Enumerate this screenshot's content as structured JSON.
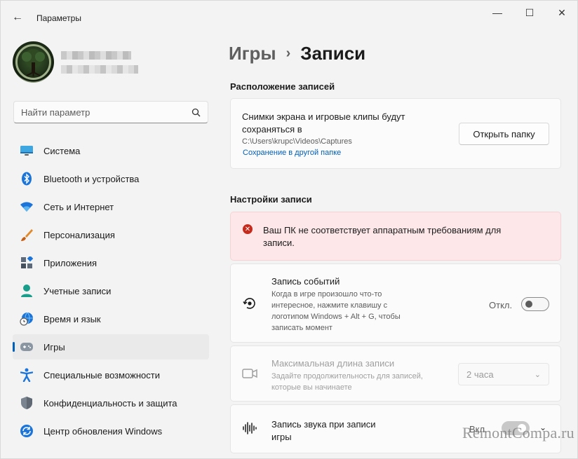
{
  "window": {
    "title": "Параметры",
    "controls": {
      "minimize": "—",
      "maximize": "☐",
      "close": "✕"
    }
  },
  "search": {
    "placeholder": "Найти параметр"
  },
  "nav": {
    "items": [
      {
        "label": "Система",
        "icon": "monitor-icon"
      },
      {
        "label": "Bluetooth и устройства",
        "icon": "bluetooth-icon"
      },
      {
        "label": "Сеть и Интернет",
        "icon": "wifi-icon"
      },
      {
        "label": "Персонализация",
        "icon": "brush-icon"
      },
      {
        "label": "Приложения",
        "icon": "apps-icon"
      },
      {
        "label": "Учетные записи",
        "icon": "account-icon"
      },
      {
        "label": "Время и язык",
        "icon": "globe-clock-icon"
      },
      {
        "label": "Игры",
        "icon": "gamepad-icon",
        "active": true
      },
      {
        "label": "Специальные возможности",
        "icon": "accessibility-icon"
      },
      {
        "label": "Конфиденциальность и защита",
        "icon": "shield-icon"
      },
      {
        "label": "Центр обновления Windows",
        "icon": "update-icon"
      }
    ]
  },
  "breadcrumb": {
    "parent": "Игры",
    "separator": "›",
    "current": "Записи"
  },
  "location": {
    "section_title": "Расположение записей",
    "text": "Снимки экрана и игровые клипы будут сохраняться в",
    "path": "C:\\Users\\krupc\\Videos\\Captures",
    "link": "Сохранение в другой папке",
    "button": "Открыть папку"
  },
  "recording": {
    "section_title": "Настройки записи",
    "error": "Ваш ПК не соответствует аппаратным требованиям для записи.",
    "events": {
      "title": "Запись событий",
      "desc": "Когда в игре произошло что-то интересное, нажмите клавишу с логотипом Windows + Alt + G, чтобы записать момент",
      "toggle_label": "Откл.",
      "toggle_on": false
    },
    "max_length": {
      "title": "Максимальная длина записи",
      "desc": "Задайте продолжительность для записей, которые вы начинаете",
      "value": "2 часа"
    },
    "audio": {
      "title": "Запись звука при записи игры",
      "toggle_label": "Вкл.",
      "toggle_on": true
    }
  },
  "watermark": "RemontCompa.ru",
  "colors": {
    "accent": "#005fb8",
    "error_bg": "#fde7e9",
    "error_icon": "#c42b1c"
  }
}
